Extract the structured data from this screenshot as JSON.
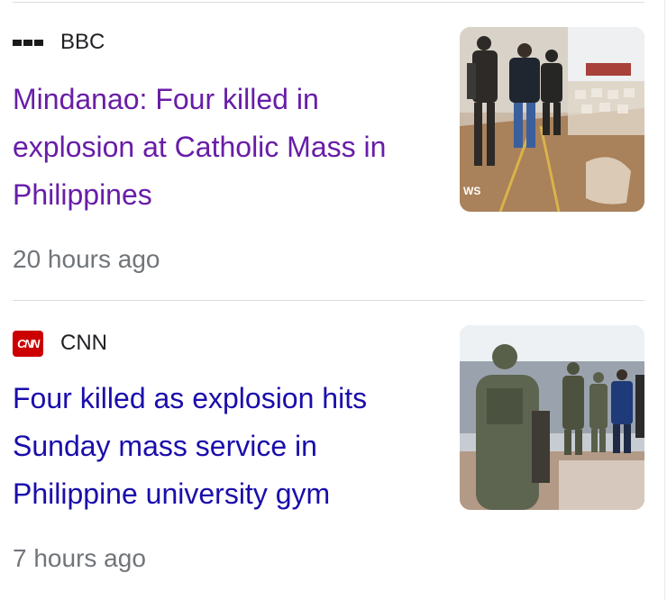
{
  "results": [
    {
      "source": "BBC",
      "logo_icon": "bbc-logo-icon",
      "headline": "Mindanao: Four killed in explosion at Catholic Mass in Philippines",
      "time": "20 hours ago",
      "visited": true,
      "thumbnail_icon": "news-photo-soldiers-hall",
      "thumbnail_watermark": "WS"
    },
    {
      "source": "CNN",
      "logo_icon": "cnn-logo-icon",
      "logo_text": "CNN",
      "headline": "Four killed as explosion hits Sunday mass service in Philippine university gym",
      "time": "7 hours ago",
      "visited": false,
      "thumbnail_icon": "news-photo-soldiers-gym"
    }
  ],
  "colors": {
    "link": "#1a0dab",
    "visited_link": "#681da8",
    "time": "#70757a",
    "cnn_red": "#cc0000"
  }
}
